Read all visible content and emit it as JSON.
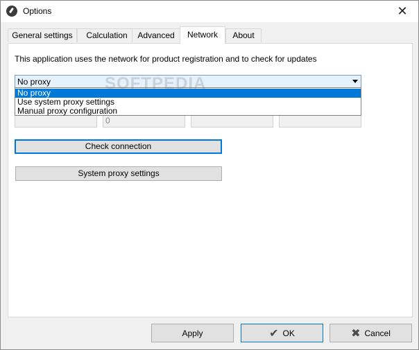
{
  "window": {
    "title": "Options",
    "close_icon": "close-icon"
  },
  "tabs": [
    {
      "label": "General settings",
      "active": false
    },
    {
      "label": "Calculation",
      "active": false
    },
    {
      "label": "Advanced",
      "active": false
    },
    {
      "label": "Network",
      "active": true
    },
    {
      "label": "About",
      "active": false
    }
  ],
  "network": {
    "info_text": "This application uses the network for product registration and to check for updates",
    "proxy_selected": "No proxy",
    "proxy_options": [
      "No proxy",
      "Use system proxy settings",
      "Manual proxy configuration"
    ],
    "fields": [
      "",
      "0",
      "",
      ""
    ],
    "check_connection_label": "Check connection",
    "system_proxy_label": "System proxy settings"
  },
  "watermark": "SOFTPEDIA",
  "footer": {
    "apply_label": "Apply",
    "ok_label": "OK",
    "cancel_label": "Cancel"
  },
  "colors": {
    "accent": "#0078d7",
    "panel_bg": "#ffffff",
    "window_bg": "#f0f0f0"
  }
}
